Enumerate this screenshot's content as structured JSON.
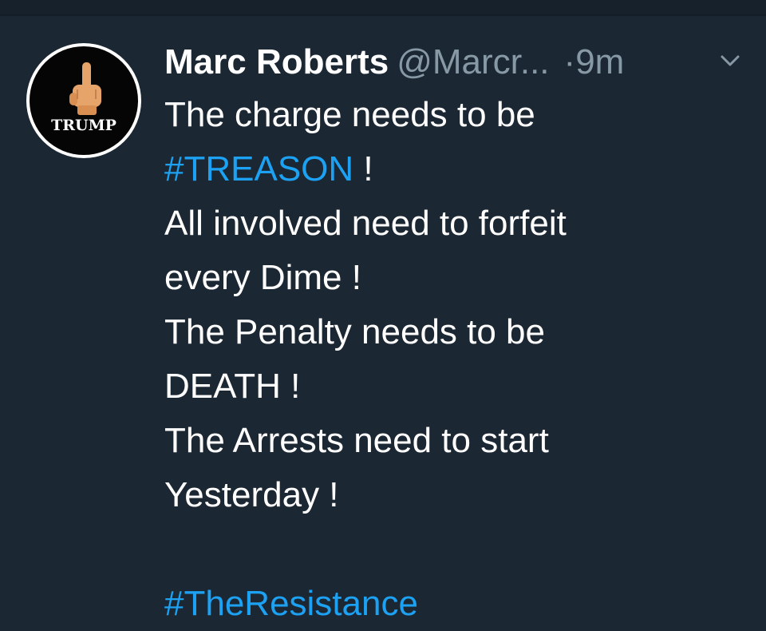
{
  "tweet": {
    "display_name": "Marc Roberts",
    "handle": "@Marcr...",
    "separator": "·",
    "time": "9m",
    "avatar": {
      "badge_text": "TRUMP",
      "icon": "middle-finger-icon"
    },
    "lines": [
      {
        "text": "The charge needs to be"
      },
      {
        "hashtag": "#TREASON",
        "suffix": " !"
      },
      {
        "text": "All involved need to forfeit"
      },
      {
        "text": "every Dime !"
      },
      {
        "text": "The Penalty needs to be"
      },
      {
        "text": "DEATH !"
      },
      {
        "text": "The Arrests need to start"
      },
      {
        "text": "Yesterday !"
      }
    ],
    "closing_hashtag": "#TheResistance"
  },
  "colors": {
    "background": "#1b2733",
    "text": "#ffffff",
    "muted": "#8899a6",
    "link": "#1da1f2"
  },
  "icons": {
    "menu": "chevron-down-icon"
  }
}
